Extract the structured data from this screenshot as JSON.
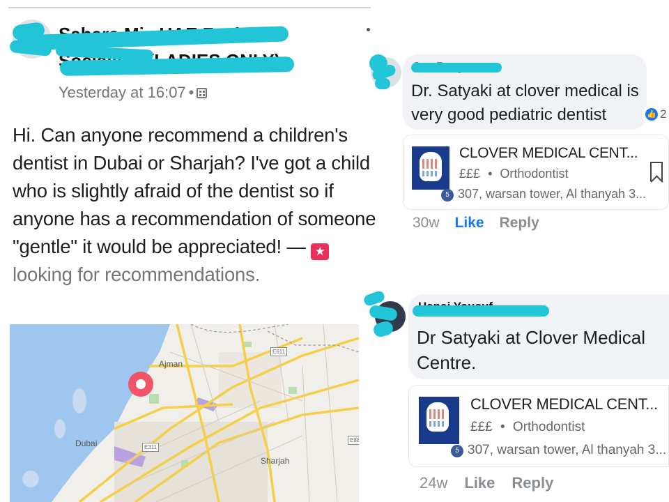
{
  "post": {
    "author": "Sahara Mix UAE Fusion Socialites (LADIES ONLY)",
    "time": "Yesterday at 16:07",
    "separator": "•",
    "icons": [
      "privacy-icon",
      "more-icon",
      "star-icon"
    ],
    "text": "Hi. Can anyone recommend a children's dentist in Dubai or Sharjah? I've got a child who is slightly afraid of the dentist so if anyone has a recommendation of someone \"gentle\" it would be appreciated! — ",
    "activity_icon": "★",
    "activity": "looking for recommendations.",
    "map": {
      "labels": {
        "ajman": "Ajman",
        "dubai": "Dubai",
        "sharjah": "Sharjah"
      },
      "signs": {
        "e611": "E611",
        "e311": "E311",
        "e88": "E88"
      }
    }
  },
  "comments": [
    {
      "name": "Jen Braganza",
      "text_line1": "Dr. Satyaki at clover medical is",
      "text_line2": "very good pediatric dentist",
      "like_count": "2",
      "place": {
        "name": "CLOVER MEDICAL CENT...",
        "price": "£££",
        "dot": "•",
        "category": "Orthodontist",
        "badge": "5",
        "address": "307, warsan tower, Al thanyah 3..."
      },
      "time": "30w",
      "like_label": "Like",
      "reply_label": "Reply"
    },
    {
      "name": "Hanai Yousuf",
      "text_line1": "Dr Satyaki at Clover Medical",
      "text_line2": "Centre.",
      "place": {
        "name": "CLOVER MEDICAL CENT...",
        "price": "£££",
        "dot": "•",
        "category": "Orthodontist",
        "badge": "5",
        "address": "307, warsan tower, Al thanyah 3..."
      },
      "time": "24w",
      "like_label": "Like",
      "reply_label": "Reply"
    }
  ],
  "colors": {
    "redaction": "#22c4d8",
    "like_blue": "#1877f2",
    "activity_pink": "#e8305a"
  }
}
